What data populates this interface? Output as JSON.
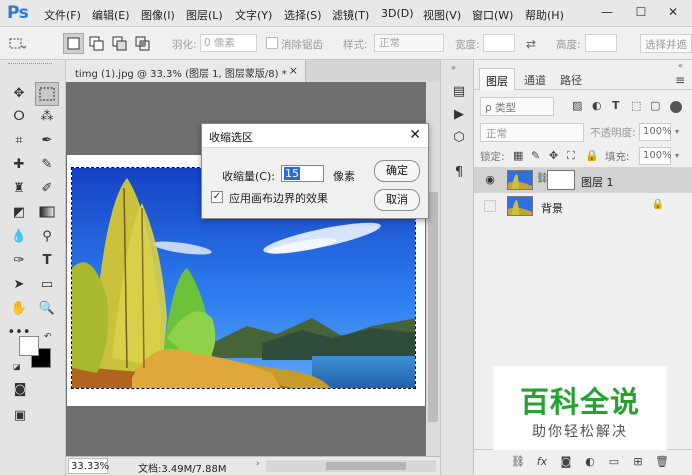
{
  "app": {
    "logo": "Ps"
  },
  "menubar": {
    "items": [
      "文件(F)",
      "编辑(E)",
      "图像(I)",
      "图层(L)",
      "文字(Y)",
      "选择(S)",
      "滤镜(T)",
      "3D(D)",
      "视图(V)",
      "窗口(W)",
      "帮助(H)"
    ],
    "window_controls": [
      "—",
      "☐",
      "✕"
    ]
  },
  "options_bar": {
    "feather_label": "羽化:",
    "feather_value": "0 像素",
    "antialias_label": "消除锯齿",
    "style_label": "样式:",
    "style_value": "正常",
    "width_label": "宽度:",
    "height_label": "高度:",
    "select_mask_label": "选择并遮"
  },
  "document": {
    "tab_title": "timg (1).jpg @ 33.3% (图层 1, 图层蒙版/8) *",
    "tab_close": "×"
  },
  "status_bar": {
    "zoom": "33.33%",
    "doc_info": "文档:3.49M/7.88M"
  },
  "dialog": {
    "title": "收缩选区",
    "close": "✕",
    "amount_label": "收缩量(C):",
    "amount_value": "15",
    "unit": "像素",
    "checkbox_label": "应用画布边界的效果",
    "checkbox_checked": "✓",
    "ok_label": "确定",
    "cancel_label": "取消"
  },
  "layers_panel": {
    "tabs": [
      "图层",
      "通道",
      "路径"
    ],
    "menu": "≡",
    "filter_label": "ρ 类型",
    "blend_mode": "正常",
    "opacity_label": "不透明度:",
    "opacity_value": "100%",
    "lock_label": "锁定:",
    "fill_label": "填充:",
    "fill_value": "100%",
    "layers": [
      {
        "name": "图层 1",
        "selected": true,
        "visible": "👁"
      },
      {
        "name": "背景",
        "selected": false,
        "locked": "🔒"
      }
    ]
  },
  "watermark": {
    "main": "百科全说",
    "sub": "助你轻松解决"
  },
  "colors": {
    "ps_blue": "#2b7ad4",
    "watermark_green": "#25a22f",
    "selection_highlight": "#2d6ad8"
  }
}
